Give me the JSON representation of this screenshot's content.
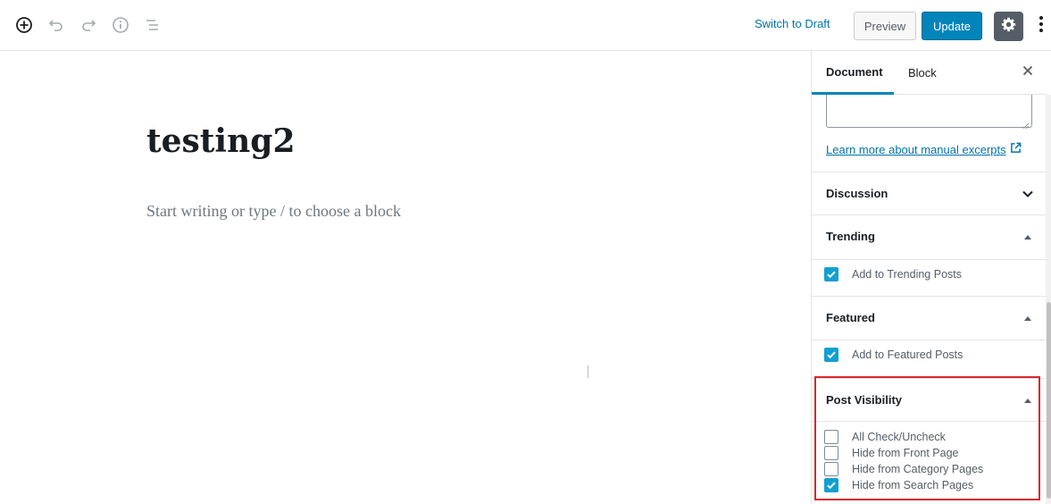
{
  "toolbar": {
    "icons": [
      "add-block-icon",
      "undo-icon",
      "redo-icon",
      "info-icon",
      "outline-icon"
    ],
    "switch_to_draft": "Switch to Draft",
    "preview": "Preview",
    "update": "Update",
    "settings_icon": "gear-icon",
    "more_icon": "more-vertical-icon"
  },
  "editor": {
    "title": "testing2",
    "placeholder": "Start writing or type / to choose a block"
  },
  "sidebar": {
    "tabs": [
      {
        "label": "Document",
        "active": true
      },
      {
        "label": "Block",
        "active": false
      }
    ],
    "excerpt": {
      "value": "",
      "learn_more": "Learn more about manual excerpts"
    },
    "panels": {
      "discussion": {
        "title": "Discussion",
        "expanded": false
      },
      "trending": {
        "title": "Trending",
        "expanded": true,
        "options": [
          {
            "label": "Add to Trending Posts",
            "checked": true
          }
        ]
      },
      "featured": {
        "title": "Featured",
        "expanded": true,
        "options": [
          {
            "label": "Add to Featured Posts",
            "checked": true
          }
        ]
      },
      "post_visibility": {
        "title": "Post Visibility",
        "expanded": true,
        "options": [
          {
            "label": "All Check/Uncheck",
            "checked": false
          },
          {
            "label": "Hide from Front Page",
            "checked": false
          },
          {
            "label": "Hide from Category Pages",
            "checked": false
          },
          {
            "label": "Hide from Search Pages",
            "checked": true
          }
        ]
      }
    }
  },
  "colors": {
    "accent": "#0085ba",
    "link": "#0073aa",
    "checkbox_checked": "#11a0d2",
    "highlight": "#d9272e"
  }
}
